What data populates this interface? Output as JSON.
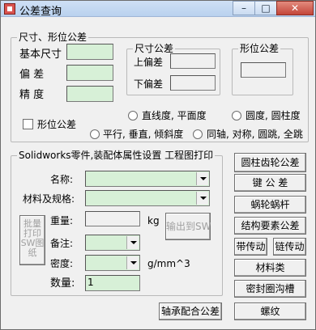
{
  "window": {
    "title": "公差查询"
  },
  "tolerance_group": {
    "label": "尺寸、形位公差",
    "basic_size_label": "基本尺寸",
    "deviation_label": "偏   差",
    "precision_label": "精   度",
    "size_tol_group": {
      "label": "尺寸公差",
      "upper_label": "上偏差",
      "lower_label": "下偏差"
    },
    "form_tol_group": {
      "label": "形位公差"
    },
    "form_tol_checkbox": "形位公差",
    "radios": [
      "直线度, 平面度",
      "圆度, 圆柱度",
      "平行, 垂直, 倾斜度",
      "同轴, 对称, 圆跳, 全跳"
    ]
  },
  "sw_group": {
    "label": "Solidworks零件,装配体属性设置 工程图打印",
    "name_label": "名称:",
    "material_label": "材料及规格:",
    "weight_label": "重量:",
    "weight_unit": "kg",
    "note_label": "备注:",
    "density_label": "密度:",
    "density_unit": "g/mm^3",
    "quantity_label": "数量:",
    "quantity_value": "1",
    "batch_print_button": "批量打印SW图纸",
    "export_sw_button": "输出到SW"
  },
  "side_buttons": {
    "cylindrical_gear": "圆柱齿轮公差",
    "key_tolerance": "键 公 差",
    "worm_gear": "蜗轮蜗杆",
    "structural_tolerance": "结构要素公差",
    "belt_drive": "带传动",
    "chain_drive": "链传动",
    "material_class": "材料类",
    "seal_groove": "密封圈沟槽",
    "thread": "螺纹"
  },
  "bottom_buttons": {
    "bearing_fit": "轴承配合公差"
  }
}
